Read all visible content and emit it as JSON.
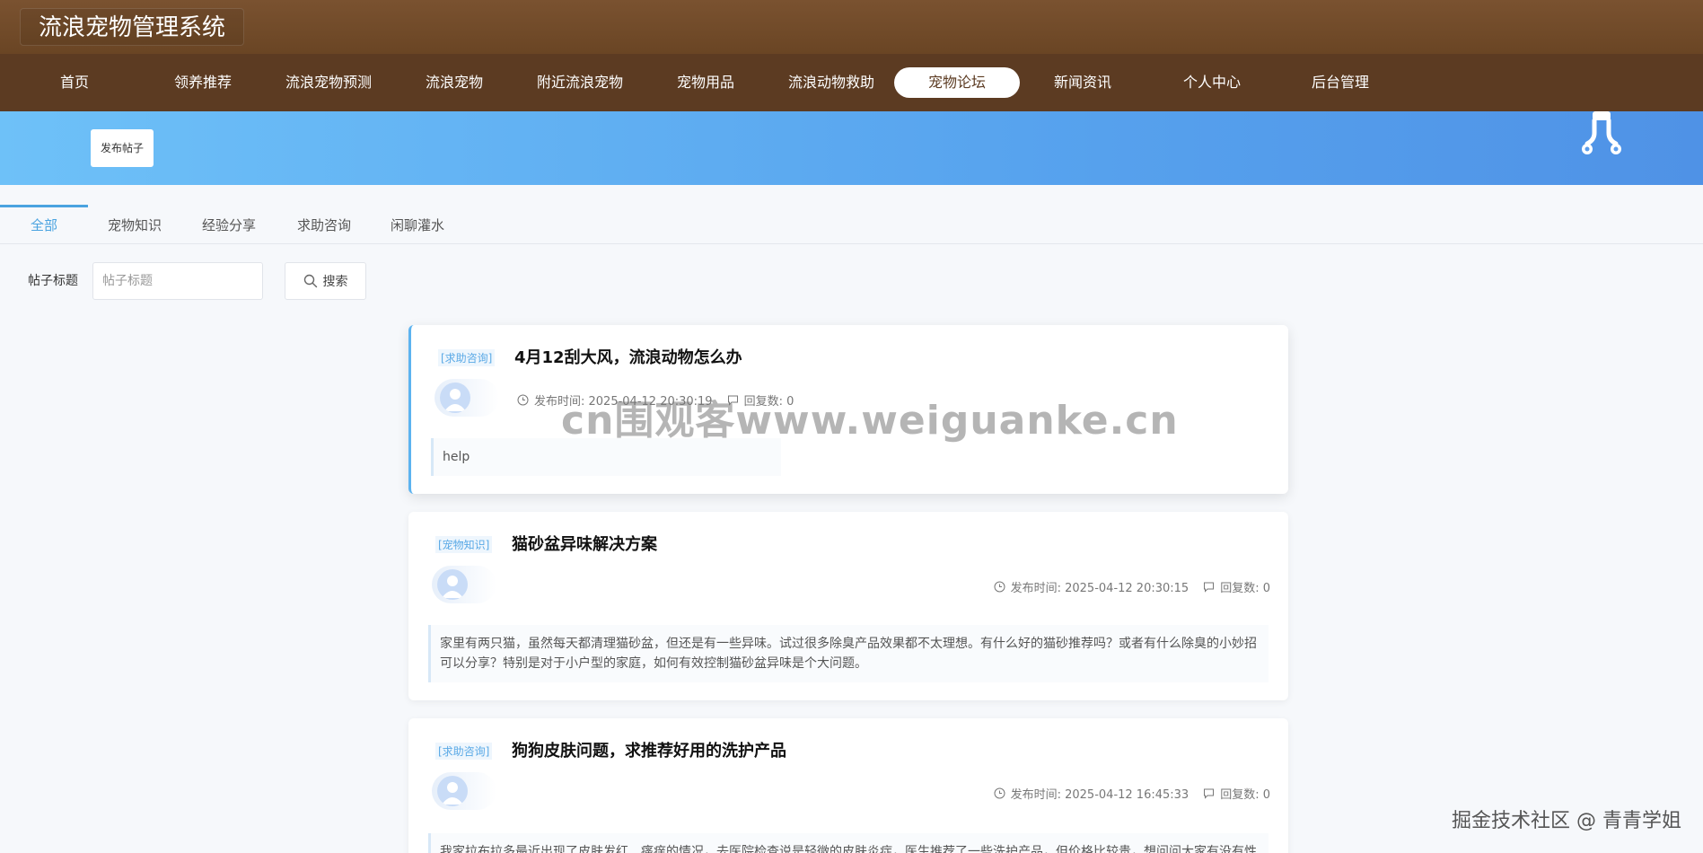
{
  "header": {
    "brand": "流浪宠物管理系统"
  },
  "nav": {
    "items": [
      {
        "label": "首页"
      },
      {
        "label": "领养推荐"
      },
      {
        "label": "流浪宠物预测"
      },
      {
        "label": "流浪宠物"
      },
      {
        "label": "附近流浪宠物"
      },
      {
        "label": "宠物用品"
      },
      {
        "label": "流浪动物救助"
      },
      {
        "label": "宠物论坛"
      },
      {
        "label": "新闻资讯"
      },
      {
        "label": "个人中心"
      },
      {
        "label": "后台管理"
      }
    ],
    "active": "宠物论坛"
  },
  "banner": {
    "publish_label": "发布帖子",
    "icon": "fork-icon"
  },
  "tabs": {
    "items": [
      {
        "label": "全部"
      },
      {
        "label": "宠物知识"
      },
      {
        "label": "经验分享"
      },
      {
        "label": "求助咨询"
      },
      {
        "label": "闲聊灌水"
      }
    ],
    "active": "全部"
  },
  "search": {
    "label": "帖子标题",
    "placeholder": "帖子标题",
    "value": "",
    "button_label": "搜索",
    "icon": "search-icon"
  },
  "posts": [
    {
      "tag": "[求助咨询]",
      "title": "4月12刮大风，流浪动物怎么办",
      "publish": "发布时间: 2025-04-12 20:30:19",
      "replies": "回复数: 0",
      "content": "help"
    },
    {
      "tag": "[宠物知识]",
      "title": "猫砂盆异味解决方案",
      "publish": "发布时间: 2025-04-12 20:30:15",
      "replies": "回复数: 0",
      "content": "家里有两只猫，虽然每天都清理猫砂盆，但还是有一些异味。试过很多除臭产品效果都不太理想。有什么好的猫砂推荐吗？或者有什么除臭的小妙招可以分享？特别是对于小户型的家庭，如何有效控制猫砂盆异味是个大问题。"
    },
    {
      "tag": "[求助咨询]",
      "title": "狗狗皮肤问题，求推荐好用的洗护产品",
      "publish": "发布时间: 2025-04-12 16:45:33",
      "replies": "回复数: 0",
      "content": "我家拉布拉多最近出现了皮肤发红、瘙痒的情况，去医院检查说是轻微的皮肤炎症，医生推荐了一些洗护产品，但价格比较贵，想问问大家有没有性"
    }
  ],
  "watermark": "cn围观客www.weiguanke.cn",
  "corner_mark": "掘金技术社区 @ 青青学姐",
  "colors": {
    "topbar": "#6a4524",
    "navbar": "#5c3b22",
    "banner_start": "#6ec1f8",
    "banner_end": "#4f92e6",
    "accent": "#4aa3e0"
  }
}
